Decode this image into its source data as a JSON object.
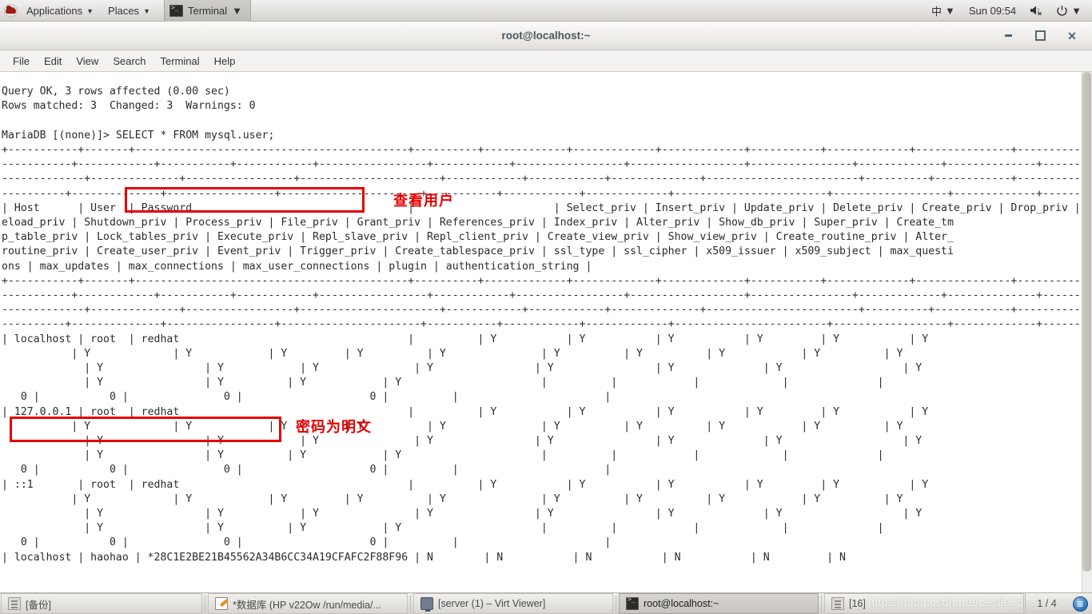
{
  "top_panel": {
    "logo_icon": "redhat-logo",
    "applications_label": "Applications",
    "places_label": "Places",
    "terminal_window_label": "Terminal",
    "caret_glyph": "▼",
    "ime_label": "中",
    "clock": "Sun 09:54",
    "volume_icon": "volume-muted-icon",
    "power_icon": "power-icon"
  },
  "window": {
    "title": "root@localhost:~",
    "minimize_label": "–",
    "maximize_label": "□",
    "close_label": "✕"
  },
  "menubar": {
    "items": [
      {
        "label": "File"
      },
      {
        "label": "Edit"
      },
      {
        "label": "View"
      },
      {
        "label": "Search"
      },
      {
        "label": "Terminal"
      },
      {
        "label": "Help"
      }
    ]
  },
  "terminal": {
    "lines": [
      "Query OK, 3 rows affected (0.00 sec)",
      "Rows matched: 3  Changed: 3  Warnings: 0",
      "",
      "MariaDB [(none)]> SELECT * FROM mysql.user;",
      "+-----------+-------+-------------------------------------------+----------+-------------+-------------+-------------+-----------+-------------+---------------+--------------+-----------+------------+-----------------+------------+------------+--",
      "-----------+------------+-----------+------------+-----------------+------------+-----------------+------------------+----------------+-------------+--------------+----------+------------+-------------+--------------+---------------+-",
      "-------------+--------------+-----------------+----------------------+------------+------------+--------------+------------------------+----------+------------+-------------+--------------+-------------+----------------+--------------",
      "----------+--------------+-----------------+----------------------+-----------+------------+-------------+------------------------+------------------+-------------+------------------+------------------------+",
      "| Host      | User  | Password                                  |                      | Select_priv | Insert_priv | Update_priv | Delete_priv | Create_priv | Drop_priv | R",
      "eload_priv | Shutdown_priv | Process_priv | File_priv | Grant_priv | References_priv | Index_priv | Alter_priv | Show_db_priv | Super_priv | Create_tm",
      "p_table_priv | Lock_tables_priv | Execute_priv | Repl_slave_priv | Repl_client_priv | Create_view_priv | Show_view_priv | Create_routine_priv | Alter_",
      "routine_priv | Create_user_priv | Event_priv | Trigger_priv | Create_tablespace_priv | ssl_type | ssl_cipher | x509_issuer | x509_subject | max_questi",
      "ons | max_updates | max_connections | max_user_connections | plugin | authentication_string |",
      "+-----------+-------+-------------------------------------------+----------+-------------+-------------+-------------+-----------+-------------+---------------+--------------+-----------+------------+-----------------+------------+------------+--",
      "-----------+------------+-----------+------------+-----------------+------------+-----------------+------------------+----------------+-------------+--------------+----------+------------+-------------+--------------+---------------+-",
      "-------------+--------------+-----------------+----------------------+------------+------------+--------------+------------------------+----------+------------+-------------+--------------+-------------+----------------+--------------",
      "----------+--------------+-----------------+----------------------+-----------+------------+-------------+------------------------+------------------+-------------+------------------+------------------------+",
      "| localhost | root  | redhat                                    |          | Y           | Y           | Y           | Y         | Y           | Y",
      "           | Y             | Y            | Y         | Y          | Y               | Y          | Y          | Y            | Y          | Y",
      "             | Y                | Y            | Y               | Y                | Y                | Y              | Y                   | Y",
      "             | Y                | Y          | Y            | Y                      |          |            |             |              |",
      "   0 |           0 |               0 |                    0 |          |                       |",
      "| 127.0.0.1 | root  | redhat                                    |          | Y           | Y           | Y           | Y         | Y           | Y",
      "           | Y             | Y            | Y         | Y          | Y               | Y          | Y          | Y            | Y          | Y",
      "             | Y                | Y            | Y               | Y                | Y                | Y              | Y                   | Y",
      "             | Y                | Y          | Y            | Y                      |          |            |             |              |",
      "   0 |           0 |               0 |                    0 |          |                       |",
      "| ::1       | root  | redhat                                    |          | Y           | Y           | Y           | Y         | Y           | Y",
      "           | Y             | Y            | Y         | Y          | Y               | Y          | Y          | Y            | Y          | Y",
      "             | Y                | Y            | Y               | Y                | Y                | Y              | Y                   | Y",
      "             | Y                | Y          | Y            | Y                      |          |            |             |              |",
      "   0 |           0 |               0 |                    0 |          |                       |",
      "| localhost | haohao | *28C1E2BE21B45562A34B6CC34A19CFAFC2F88F96 | N        | N           | N           | N           | N         | N"
    ]
  },
  "annotations": {
    "command_box_label": "SELECT * FROM mysql.user;",
    "command_note": "查看用户",
    "row_box_label": "| localhost | root  | redhat",
    "row_note": "密码为明文",
    "accent_color": "#e60000"
  },
  "taskbar": {
    "items": [
      {
        "label": "[备份]",
        "icon": "archive-icon",
        "state": "flat"
      },
      {
        "label": "*数据库 (HP v22Ow /run/media/...",
        "icon": "note-icon",
        "state": "flat"
      },
      {
        "label": "[server (1) – Virt Viewer]",
        "icon": "monitor-icon",
        "state": "flat"
      },
      {
        "label": "root@localhost:~",
        "icon": "terminal-icon",
        "state": "raised"
      },
      {
        "label": "[16]",
        "icon": "archive-icon",
        "state": "flat"
      }
    ],
    "watermark": "https://blog.csdn.net/Leslie_q",
    "page_indicator": "1 / 4",
    "workspace_glyph": "≣"
  }
}
